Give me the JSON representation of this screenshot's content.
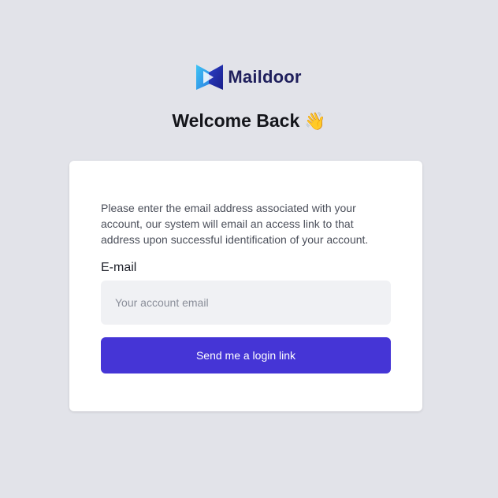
{
  "brand": {
    "name": "Maildoor",
    "logo_icon": "maildoor-logo-icon"
  },
  "heading": {
    "text": "Welcome Back",
    "emoji": "👋"
  },
  "form": {
    "intro": "Please enter the email address associated with your account, our system will email an access link to that address upon successful identification of your account.",
    "email_label": "E-mail",
    "email_placeholder": "Your account email",
    "email_value": "",
    "submit_label": "Send me a login link"
  },
  "colors": {
    "background": "#e2e3e9",
    "card": "#ffffff",
    "input_bg": "#f0f1f4",
    "primary_button": "#4535d6",
    "brand_text": "#1f1f5c"
  }
}
